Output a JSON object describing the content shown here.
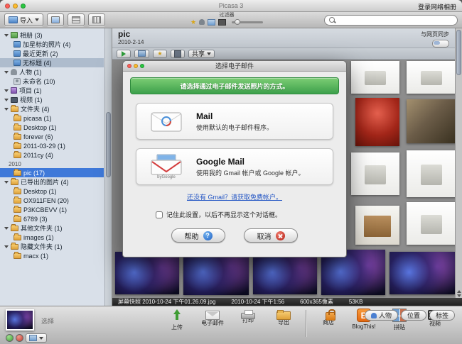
{
  "window": {
    "title": "Picasa 3",
    "signin_label": "登录网络相册"
  },
  "toolbar": {
    "import_label": "导入",
    "filter_label": "过滤器",
    "search_value": ""
  },
  "sidebar": {
    "items": [
      {
        "label": "相册 (3)",
        "type": "header",
        "icon": "albums"
      },
      {
        "label": "加星标的照片 (4)",
        "type": "child",
        "icon": "album"
      },
      {
        "label": "最近更新 (2)",
        "type": "child",
        "icon": "album"
      },
      {
        "label": "无标题 (4)",
        "type": "child",
        "icon": "album",
        "selected": "inactive"
      },
      {
        "label": "人物 (1)",
        "type": "header",
        "icon": "people"
      },
      {
        "label": "未命名 (10)",
        "type": "child",
        "icon": "face"
      },
      {
        "label": "项目 (1)",
        "type": "header",
        "icon": "projects"
      },
      {
        "label": "视频 (1)",
        "type": "header",
        "icon": "videos"
      },
      {
        "label": "文件夹 (4)",
        "type": "header",
        "icon": "folders"
      },
      {
        "label": "picasa (1)",
        "type": "child",
        "icon": "folder"
      },
      {
        "label": "Desktop (1)",
        "type": "child",
        "icon": "folder"
      },
      {
        "label": "forever (6)",
        "type": "child",
        "icon": "folder"
      },
      {
        "label": "2011-03-29 (1)",
        "type": "child",
        "icon": "folder"
      },
      {
        "label": "2011cy (4)",
        "type": "child",
        "icon": "folder"
      },
      {
        "label": "2010",
        "type": "year"
      },
      {
        "label": "pic (17)",
        "type": "child",
        "icon": "folder",
        "selected": "active"
      },
      {
        "label": "已导出的图片 (4)",
        "type": "header",
        "icon": "folders"
      },
      {
        "label": "Desktop (1)",
        "type": "child",
        "icon": "folder"
      },
      {
        "label": "OX911FEN (20)",
        "type": "child",
        "icon": "folder"
      },
      {
        "label": "P3KCBEVV (1)",
        "type": "child",
        "icon": "folder"
      },
      {
        "label": "6789 (3)",
        "type": "child",
        "icon": "folder"
      },
      {
        "label": "其他文件夹 (1)",
        "type": "header",
        "icon": "folders"
      },
      {
        "label": "images (1)",
        "type": "child",
        "icon": "folder"
      },
      {
        "label": "隐藏文件夹 (1)",
        "type": "header",
        "icon": "folders"
      },
      {
        "label": "macx (1)",
        "type": "child",
        "icon": "folder"
      }
    ]
  },
  "content": {
    "title": "pic",
    "date": "2010-2-14",
    "sync_label": "与网页同步",
    "share_label": "共享"
  },
  "dialog": {
    "title": "选择电子邮件",
    "banner": "请选择通过电子邮件发送照片的方式。",
    "options": [
      {
        "title": "Mail",
        "desc": "使用默认的电子邮件程序。"
      },
      {
        "title": "Google Mail",
        "desc": "使用我的 Gmail 帐户或 Google 帐户。",
        "badge": "byGoogle"
      }
    ],
    "link": "还没有 Gmail？请获取免费帐户。",
    "checkbox_label": "记住此设置，以后不再显示这个对话框。",
    "checkbox_checked": false,
    "buttons": {
      "help": "帮助",
      "cancel": "取消"
    }
  },
  "statusbar": {
    "filename": "屏幕快照 2010-10-24 下午01.26.09.jpg",
    "datetime": "2010-10-24 下午1:56",
    "dimensions": "600x365像素",
    "filesize": "53KB"
  },
  "bottombar": {
    "selection_label": "选择",
    "actions": [
      {
        "label": "上传",
        "icon": "upload",
        "name": "upload-button"
      },
      {
        "label": "电子邮件",
        "icon": "email",
        "name": "email-button"
      },
      {
        "label": "打印",
        "icon": "print",
        "name": "print-button"
      },
      {
        "label": "导出",
        "icon": "export",
        "name": "export-button"
      },
      {
        "sep": true
      },
      {
        "label": "商店",
        "icon": "shop",
        "name": "shop-button"
      },
      {
        "label": "BlogThis!",
        "icon": "blog",
        "name": "blogthis-button"
      },
      {
        "label": "拼贴",
        "icon": "collage",
        "name": "collage-button"
      },
      {
        "label": "视频",
        "icon": "movie",
        "name": "movie-button"
      }
    ],
    "panels": [
      {
        "label": "人物",
        "icon": "person",
        "name": "panel-people-button"
      },
      {
        "label": "位置",
        "name": "panel-places-button"
      },
      {
        "label": "标签",
        "name": "panel-tags-button"
      }
    ]
  },
  "colors": {
    "selection_blue": "#3f79d9",
    "dialog_green": "#44a94f",
    "statusbar_bg": "#2e2e2e"
  }
}
